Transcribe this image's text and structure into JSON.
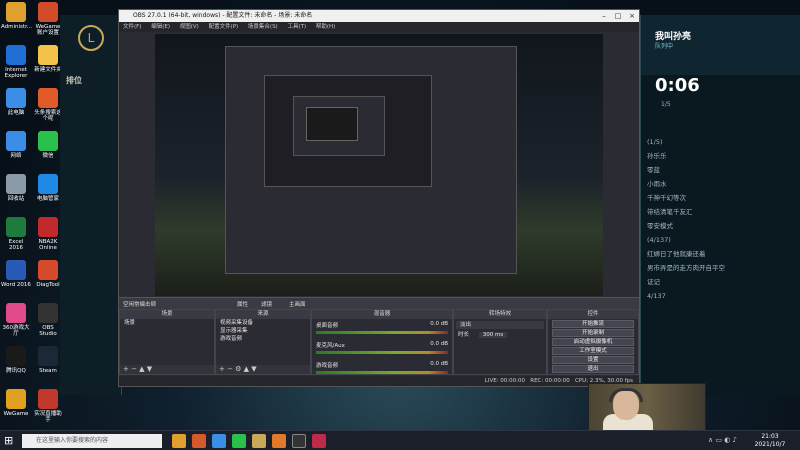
{
  "desktop": {
    "icons": [
      {
        "label": "Administr...",
        "color": "#e0a030"
      },
      {
        "label": "WeGame账户设置",
        "color": "#d34c2a"
      },
      {
        "label": "Internet Explorer",
        "color": "#1f6fd6"
      },
      {
        "label": "新建文件夹",
        "color": "#f2c24a"
      },
      {
        "label": "此电脑",
        "color": "#3a8ee6"
      },
      {
        "label": "头条搜索这个呢",
        "color": "#e05a2a"
      },
      {
        "label": "网络",
        "color": "#3a8ee6"
      },
      {
        "label": "微信",
        "color": "#2bbf4b"
      },
      {
        "label": "回收站",
        "color": "#8a9aa8"
      },
      {
        "label": "电脑管家",
        "color": "#1e8ae6"
      },
      {
        "label": "Excel 2016",
        "color": "#1f7a3e"
      },
      {
        "label": "NBA2K Online",
        "color": "#c02a2a"
      },
      {
        "label": "Word 2016",
        "color": "#2a5ab8"
      },
      {
        "label": "DiagTool",
        "color": "#d44a2a"
      },
      {
        "label": "360游戏大厅",
        "color": "#e04a8a"
      },
      {
        "label": "OBS Studio",
        "color": "#333333"
      },
      {
        "label": "腾讯QQ",
        "color": "#1a1a1a"
      },
      {
        "label": "Steam",
        "color": "#1b2838"
      },
      {
        "label": "WeGame",
        "color": "#e0a020"
      },
      {
        "label": "实况直播助手",
        "color": "#c0392b"
      }
    ]
  },
  "lol_client": {
    "rank_label": "排位",
    "player_name": "我叫孙亮",
    "team_label": "队列中",
    "timer": "0:06",
    "sub_timer": "1/5",
    "list": [
      "(1/5)",
      "孙乐乐",
      "零蓝",
      "小雨水",
      "千神千幻等次",
      "带结清笔千友汇",
      "零安模式",
      "(4/137)",
      "红蛳日了他就康还着",
      "男市弄是的走方肉开自平空",
      "证记",
      "4/137"
    ]
  },
  "obs": {
    "title": "OBS 27.0.1 (64-bit, windows) - 配置文件: 未命名 - 场景: 未命名",
    "menu": [
      "文件(F)",
      "编辑(E)",
      "视图(V)",
      "配置文件(P)",
      "场景集合(S)",
      "工具(T)",
      "帮助(H)"
    ],
    "dock_bar": {
      "left_label": "空闲常编击顿",
      "props": "属性",
      "filters": "滤镜",
      "preview_label": "主画面"
    },
    "scenes": {
      "header": "场景",
      "items": [
        "场景"
      ]
    },
    "sources": {
      "header": "来源",
      "items": [
        "视频采集设备",
        "显示器采集",
        "游戏音频"
      ]
    },
    "mixer": {
      "header": "混音器",
      "items": [
        {
          "name": "桌面音频",
          "db": "0.0 dB"
        },
        {
          "name": "麦克风/Aux",
          "db": "0.0 dB"
        },
        {
          "name": "游戏音频",
          "db": "0.0 dB"
        }
      ]
    },
    "transitions": {
      "header": "转场特效",
      "type": "淡出",
      "duration_label": "时长",
      "duration": "300 ms"
    },
    "controls": {
      "header": "控件",
      "buttons": [
        "开始推流",
        "开始录制",
        "启动虚拟摄像机",
        "工作室模式",
        "设置",
        "退出"
      ]
    },
    "status": {
      "live": "LIVE: 00:00:00",
      "rec": "REC: 00:00:00",
      "cpu": "CPU: 2.3%, 30.00 fps"
    }
  },
  "taskbar": {
    "search_placeholder": "在这里输入你要搜索的内容",
    "time": "21:03",
    "date": "2021/10/7"
  }
}
